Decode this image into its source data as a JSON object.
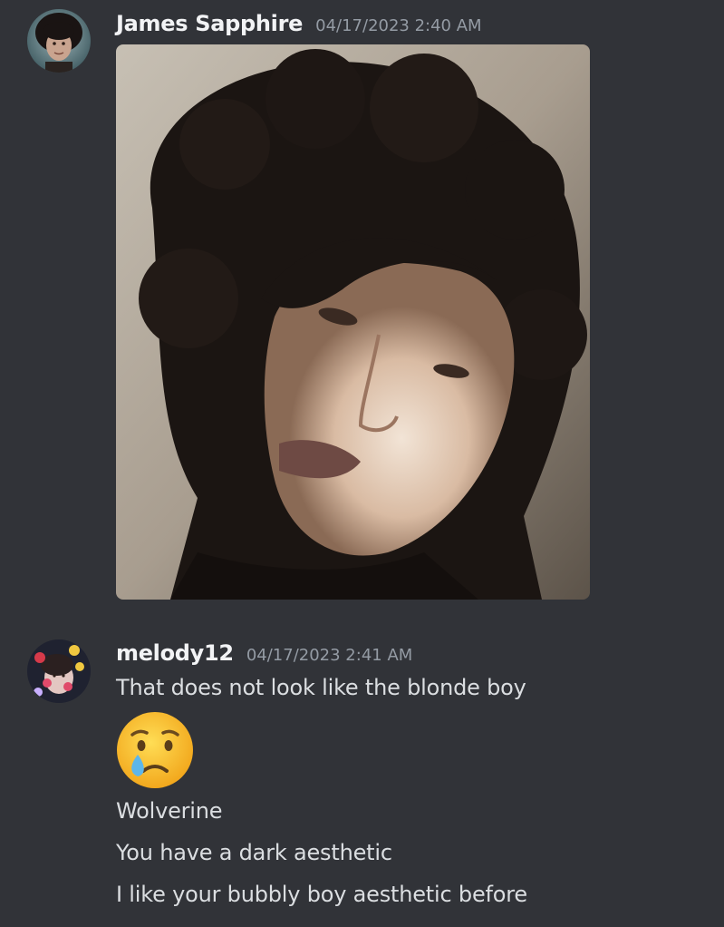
{
  "messages": [
    {
      "username": "James Sapphire",
      "timestamp": "04/17/2023 2:40 AM",
      "attachment": "image",
      "accent": "#f2f3f5"
    },
    {
      "username": "melody12",
      "timestamp": "04/17/2023 2:41 AM",
      "lines": [
        "That does not look like the blonde boy",
        "Wolverine",
        "You have a dark aesthetic",
        "I like your bubbly boy aesthetic before"
      ],
      "emoji": "crying-face-emoji"
    }
  ],
  "colors": {
    "background": "#313338",
    "username": "#f2f3f5",
    "timestamp": "#949ba4",
    "text": "#dbdee1"
  }
}
